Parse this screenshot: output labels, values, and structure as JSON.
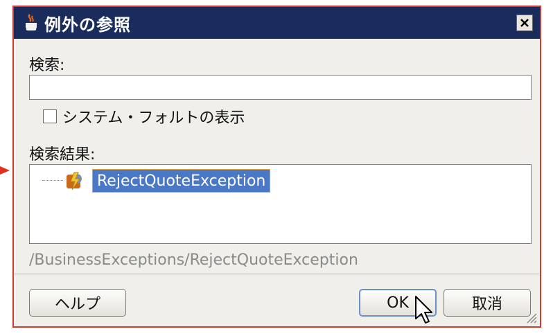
{
  "window": {
    "title": "例外の参照"
  },
  "search": {
    "label": "検索:",
    "value": ""
  },
  "show_system_faults": {
    "label": "システム・フォルトの表示",
    "checked": false
  },
  "results": {
    "label": "検索結果:",
    "items": [
      {
        "label": "RejectQuoteException",
        "selected": true,
        "icon": "exception-icon"
      }
    ]
  },
  "selected_path": "/BusinessExceptions/RejectQuoteException",
  "buttons": {
    "help": "ヘルプ",
    "ok": "OK",
    "cancel": "取消"
  },
  "colors": {
    "titlebar": "#1a2c5c",
    "selection": "#4a78c4",
    "highlight_border": "#d23a2e"
  }
}
